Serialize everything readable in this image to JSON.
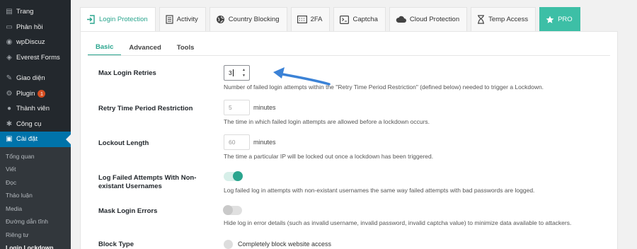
{
  "sidebar": {
    "items": [
      {
        "label": "Trang",
        "icon": "page-icon"
      },
      {
        "label": "Phản hồi",
        "icon": "comments-icon"
      },
      {
        "label": "wpDiscuz",
        "icon": "discuz-icon"
      },
      {
        "label": "Everest Forms",
        "icon": "forms-icon"
      },
      {
        "label": "Giao diện",
        "icon": "appearance-icon"
      },
      {
        "label": "Plugin",
        "icon": "plugin-icon",
        "badge": "1"
      },
      {
        "label": "Thành viên",
        "icon": "users-icon"
      },
      {
        "label": "Công cụ",
        "icon": "tools-icon"
      },
      {
        "label": "Cài đặt",
        "icon": "settings-icon"
      }
    ],
    "submenu": [
      "Tổng quan",
      "Viết",
      "Đọc",
      "Thảo luận",
      "Media",
      "Đường dẫn tĩnh",
      "Riêng tư",
      "Login Lockdown"
    ]
  },
  "tabs": [
    {
      "label": "Login Protection",
      "icon": "login-icon"
    },
    {
      "label": "Activity",
      "icon": "activity-icon"
    },
    {
      "label": "Country Blocking",
      "icon": "globe-icon"
    },
    {
      "label": "2FA",
      "icon": "2fa-icon"
    },
    {
      "label": "Captcha",
      "icon": "captcha-icon"
    },
    {
      "label": "Cloud Protection",
      "icon": "cloud-icon"
    },
    {
      "label": "Temp Access",
      "icon": "hourglass-icon"
    },
    {
      "label": "PRO",
      "icon": "star-icon"
    }
  ],
  "subtabs": [
    "Basic",
    "Advanced",
    "Tools"
  ],
  "settings": {
    "max_retries": {
      "label": "Max Login Retries",
      "value": "3",
      "description": "Number of failed login attempts within the \"Retry Time Period Restriction\" (defined below) needed to trigger a Lockdown."
    },
    "retry_period": {
      "label": "Retry Time Period Restriction",
      "value": "5",
      "unit": "minutes",
      "description": "The time in which failed login attempts are allowed before a lockdown occurs."
    },
    "lockout_length": {
      "label": "Lockout Length",
      "value": "60",
      "unit": "minutes",
      "description": "The time a particular IP will be locked out once a lockdown has been triggered."
    },
    "log_failed": {
      "label": "Log Failed Attempts With Non-existant Usernames",
      "state": "on",
      "description": "Log failed log in attempts with non-existant usernames the same way failed attempts with bad passwords are logged."
    },
    "mask_errors": {
      "label": "Mask Login Errors",
      "state": "off",
      "description": "Hide log in error details (such as invalid username, invalid password, invalid captcha value) to minimize data available to attackers."
    },
    "block_type": {
      "label": "Block Type",
      "option": "Completely block website access"
    }
  },
  "colors": {
    "accent": "#2aa58e",
    "wp_blue": "#0073aa",
    "sidebar_bg": "#23282d",
    "arrow": "#3b82d6"
  }
}
